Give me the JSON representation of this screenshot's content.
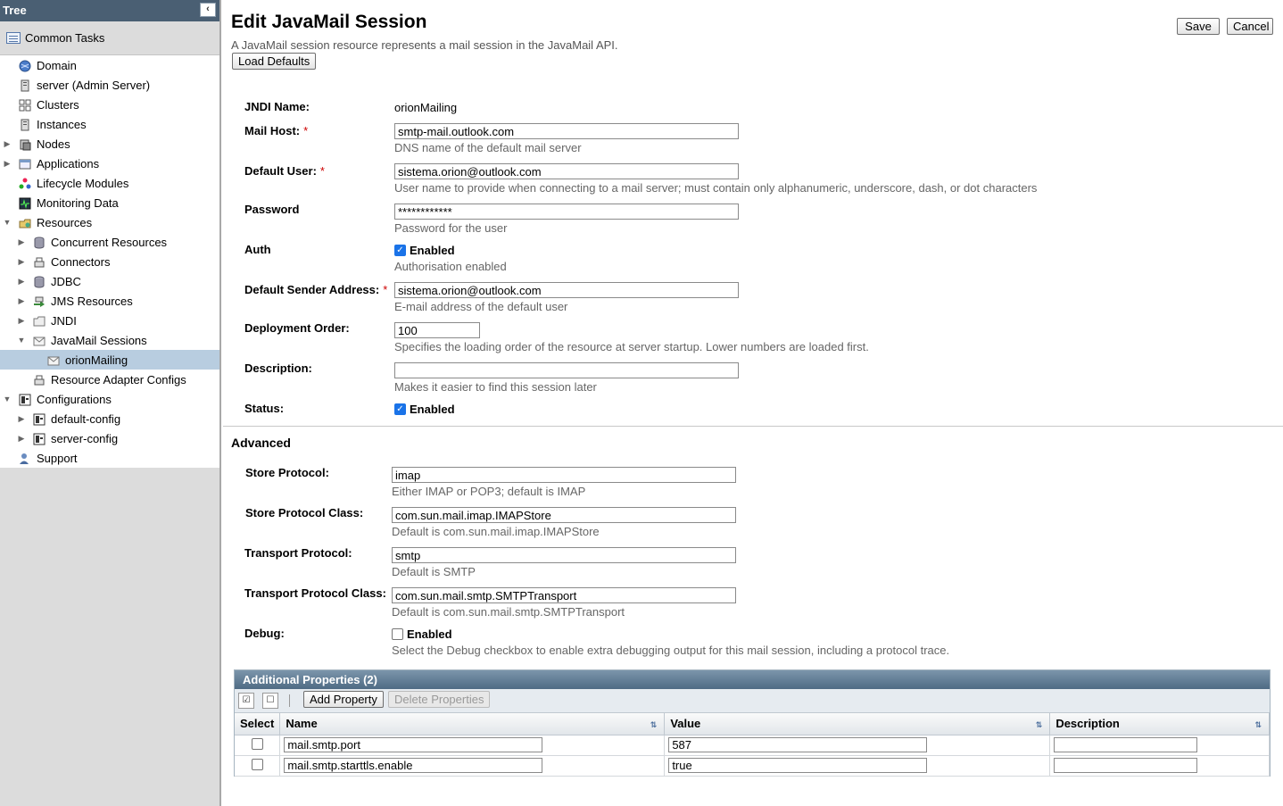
{
  "tree": {
    "header": "Tree",
    "collapse_icon": "‹",
    "common_tasks": "Common Tasks",
    "nodes": [
      {
        "label": "Domain",
        "icon": "globe-icon"
      },
      {
        "label": "server (Admin Server)",
        "icon": "server-icon"
      },
      {
        "label": "Clusters",
        "icon": "cluster-icon"
      },
      {
        "label": "Instances",
        "icon": "server-icon"
      },
      {
        "label": "Nodes",
        "icon": "node-icon"
      },
      {
        "label": "Applications",
        "icon": "applications-icon"
      },
      {
        "label": "Lifecycle Modules",
        "icon": "lifecycle-icon"
      },
      {
        "label": "Monitoring Data",
        "icon": "monitor-icon"
      },
      {
        "label": "Resources",
        "icon": "resources-icon"
      },
      {
        "label": "Concurrent Resources",
        "icon": "database-icon"
      },
      {
        "label": "Connectors",
        "icon": "connector-icon"
      },
      {
        "label": "JDBC",
        "icon": "database-icon"
      },
      {
        "label": "JMS Resources",
        "icon": "jms-icon"
      },
      {
        "label": "JNDI",
        "icon": "folder-icon"
      },
      {
        "label": "JavaMail Sessions",
        "icon": "mail-icon"
      },
      {
        "label": "orionMailing",
        "icon": "mail-icon"
      },
      {
        "label": "Resource Adapter Configs",
        "icon": "connector-icon"
      },
      {
        "label": "Configurations",
        "icon": "config-icon"
      },
      {
        "label": "default-config",
        "icon": "config-icon"
      },
      {
        "label": "server-config",
        "icon": "config-icon"
      },
      {
        "label": "Support",
        "icon": "support-icon"
      }
    ]
  },
  "page": {
    "title": "Edit JavaMail Session",
    "description": "A JavaMail session resource represents a mail session in the JavaMail API.",
    "load_defaults": "Load Defaults",
    "save": "Save",
    "cancel": "Cancel"
  },
  "form": {
    "jndi_label": "JNDI Name:",
    "jndi_value": "orionMailing",
    "mail_host_label": "Mail Host:",
    "mail_host_value": "smtp-mail.outlook.com",
    "mail_host_help": "DNS name of the default mail server",
    "default_user_label": "Default User:",
    "default_user_value": "sistema.orion@outlook.com",
    "default_user_help": "User name to provide when connecting to a mail server; must contain only alphanumeric, underscore, dash, or dot characters",
    "password_label": "Password",
    "password_value": "************",
    "password_help": "Password for the user",
    "auth_label": "Auth",
    "auth_checkbox": "Enabled",
    "auth_help": "Authorisation enabled",
    "sender_label": "Default Sender Address:",
    "sender_value": "sistema.orion@outlook.com",
    "sender_help": "E-mail address of the default user",
    "order_label": "Deployment Order:",
    "order_value": "100",
    "order_help": "Specifies the loading order of the resource at server startup. Lower numbers are loaded first.",
    "desc_label": "Description:",
    "desc_value": "",
    "desc_help": "Makes it easier to find this session later",
    "status_label": "Status:",
    "status_checkbox": "Enabled",
    "required_mark": "*"
  },
  "advanced": {
    "heading": "Advanced",
    "store_label": "Store Protocol:",
    "store_value": "imap",
    "store_help": "Either IMAP or POP3; default is IMAP",
    "store_class_label": "Store Protocol Class:",
    "store_class_value": "com.sun.mail.imap.IMAPStore",
    "store_class_help": "Default is com.sun.mail.imap.IMAPStore",
    "transport_label": "Transport Protocol:",
    "transport_value": "smtp",
    "transport_help": "Default is SMTP",
    "transport_class_label": "Transport Protocol Class:",
    "transport_class_value": "com.sun.mail.smtp.SMTPTransport",
    "transport_class_help": "Default is com.sun.mail.smtp.SMTPTransport",
    "debug_label": "Debug:",
    "debug_checkbox": "Enabled",
    "debug_help": "Select the Debug checkbox to enable extra debugging output for this mail session, including a protocol trace."
  },
  "properties": {
    "title": "Additional Properties (2)",
    "add": "Add Property",
    "delete": "Delete Properties",
    "columns": {
      "select": "Select",
      "name": "Name",
      "value": "Value",
      "description": "Description"
    },
    "rows": [
      {
        "name": "mail.smtp.port",
        "value": "587",
        "description": ""
      },
      {
        "name": "mail.smtp.starttls.enable",
        "value": "true",
        "description": ""
      }
    ]
  }
}
